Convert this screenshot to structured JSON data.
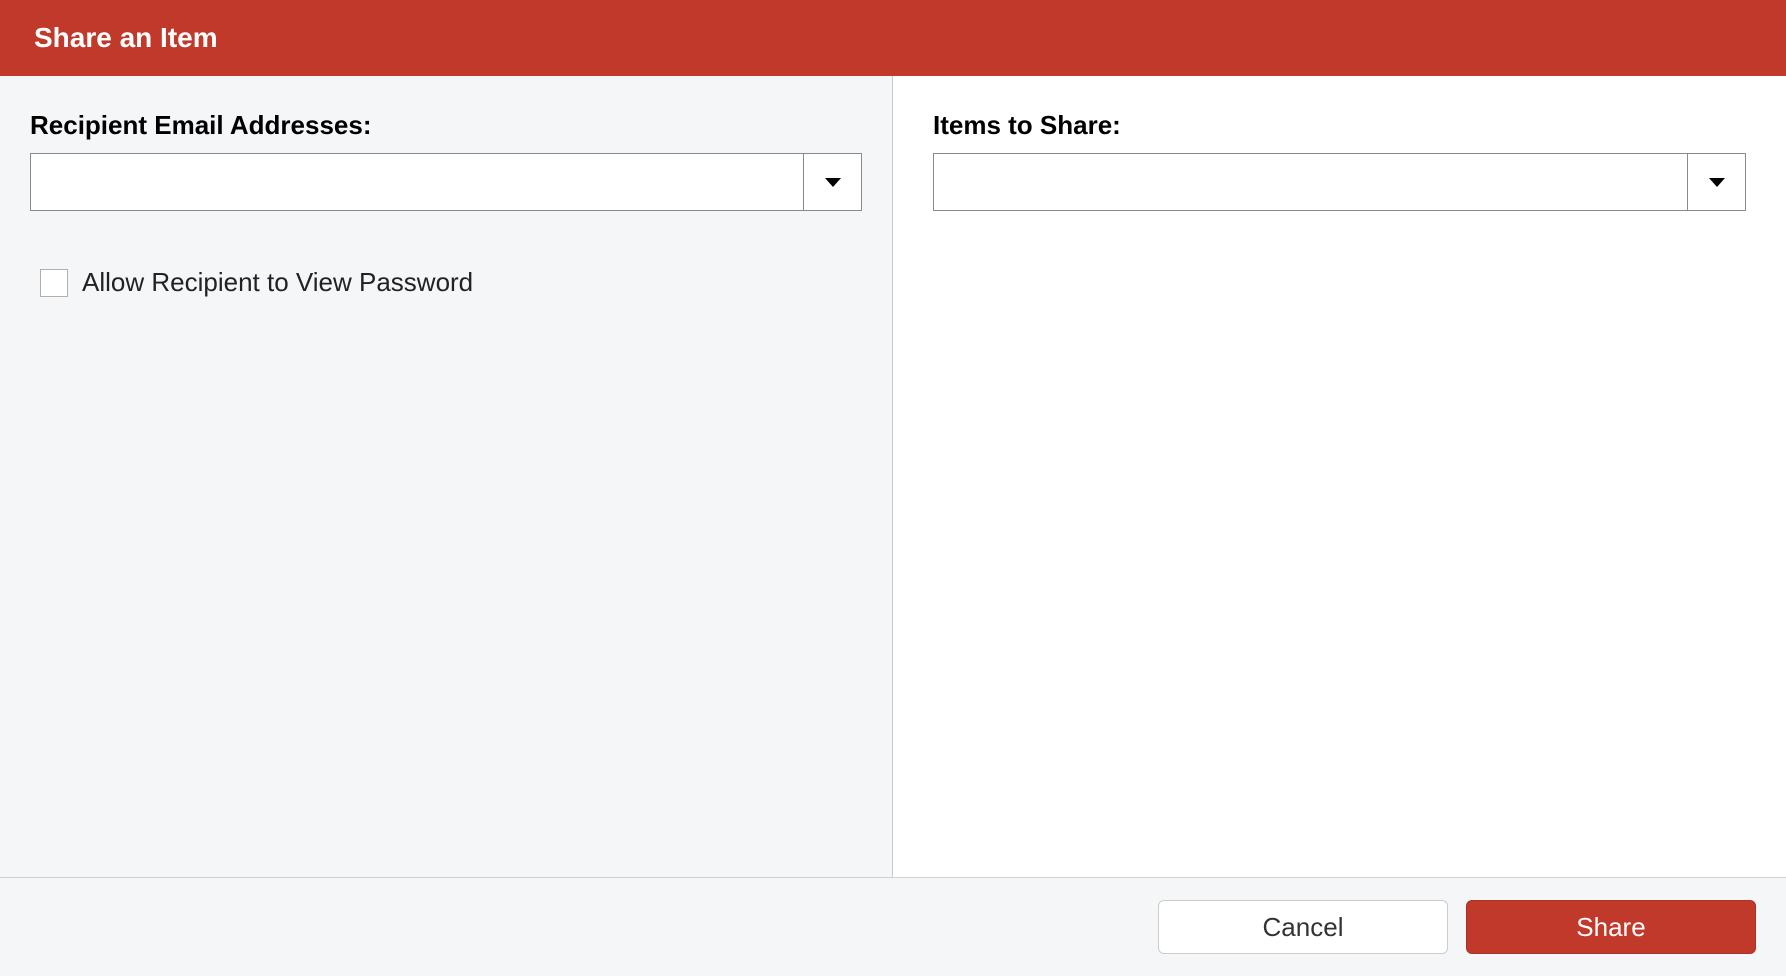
{
  "header": {
    "title": "Share an Item"
  },
  "left": {
    "label": "Recipient Email Addresses:",
    "value": "",
    "checkbox_label": "Allow Recipient to View Password",
    "checkbox_checked": false
  },
  "right": {
    "label": "Items to Share:",
    "value": ""
  },
  "footer": {
    "cancel": "Cancel",
    "share": "Share"
  },
  "colors": {
    "accent": "#c0392b"
  }
}
